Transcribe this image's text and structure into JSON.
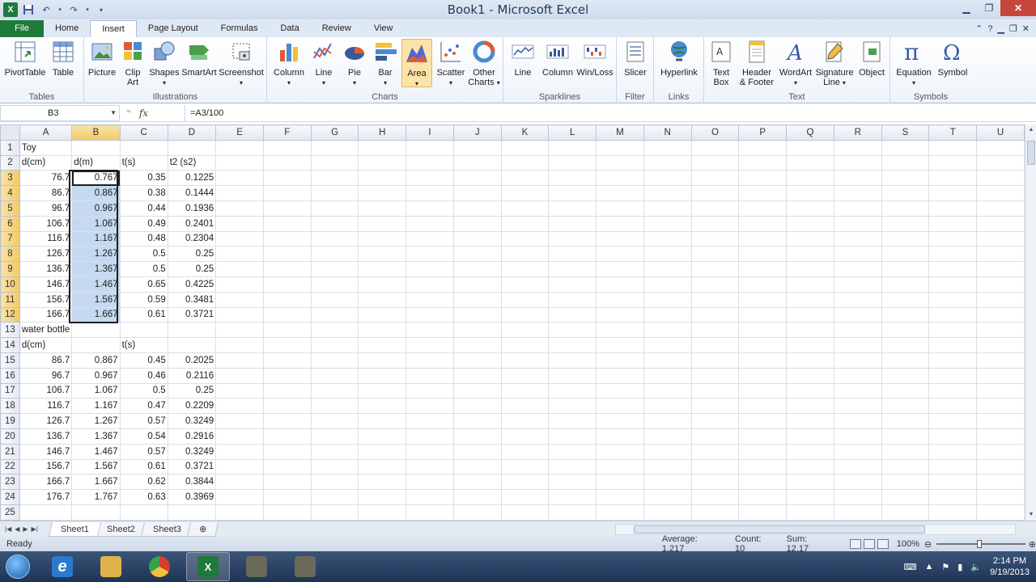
{
  "window": {
    "title": "Book1 - Microsoft Excel",
    "app_icon": "X"
  },
  "tabs": [
    {
      "label": "File"
    },
    {
      "label": "Home"
    },
    {
      "label": "Insert"
    },
    {
      "label": "Page Layout"
    },
    {
      "label": "Formulas"
    },
    {
      "label": "Data"
    },
    {
      "label": "Review"
    },
    {
      "label": "View"
    }
  ],
  "ribbon": {
    "groups": {
      "tables": "Tables",
      "illustrations": "Illustrations",
      "charts": "Charts",
      "sparklines": "Sparklines",
      "filter": "Filter",
      "links": "Links",
      "text": "Text",
      "symbols": "Symbols"
    },
    "buttons": {
      "pivottable": "PivotTable",
      "table": "Table",
      "picture": "Picture",
      "clipart_1": "Clip",
      "clipart_2": "Art",
      "shapes": "Shapes",
      "smartart": "SmartArt",
      "screenshot": "Screenshot",
      "column": "Column",
      "line": "Line",
      "pie": "Pie",
      "bar": "Bar",
      "area": "Area",
      "scatter": "Scatter",
      "othercharts_1": "Other",
      "othercharts_2": "Charts",
      "spark_line": "Line",
      "spark_column": "Column",
      "spark_winloss": "Win/Loss",
      "slicer": "Slicer",
      "hyperlink": "Hyperlink",
      "textbox_1": "Text",
      "textbox_2": "Box",
      "header_1": "Header",
      "header_2": "& Footer",
      "wordart": "WordArt",
      "signature_1": "Signature",
      "signature_2": "Line",
      "object": "Object",
      "equation": "Equation",
      "symbol": "Symbol"
    }
  },
  "formula_bar": {
    "name_box": "B3",
    "fx": "fx",
    "formula": "=A3/100"
  },
  "sheet": {
    "columns": [
      "A",
      "B",
      "C",
      "D",
      "E",
      "F",
      "G",
      "H",
      "I",
      "J",
      "K",
      "L",
      "M",
      "N",
      "O",
      "P",
      "Q",
      "R",
      "S",
      "T",
      "U"
    ],
    "rows": [
      {
        "n": "1",
        "a": "Toy",
        "b": "",
        "c": "",
        "d": ""
      },
      {
        "n": "2",
        "a": "d(cm)",
        "b": "d(m)",
        "c": "t(s)",
        "d": "t2 (s2)"
      },
      {
        "n": "3",
        "a": "76.7",
        "b": "0.767",
        "c": "0.35",
        "d": "0.1225"
      },
      {
        "n": "4",
        "a": "86.7",
        "b": "0.867",
        "c": "0.38",
        "d": "0.1444"
      },
      {
        "n": "5",
        "a": "96.7",
        "b": "0.967",
        "c": "0.44",
        "d": "0.1936"
      },
      {
        "n": "6",
        "a": "106.7",
        "b": "1.067",
        "c": "0.49",
        "d": "0.2401"
      },
      {
        "n": "7",
        "a": "116.7",
        "b": "1.167",
        "c": "0.48",
        "d": "0.2304"
      },
      {
        "n": "8",
        "a": "126.7",
        "b": "1.267",
        "c": "0.5",
        "d": "0.25"
      },
      {
        "n": "9",
        "a": "136.7",
        "b": "1.367",
        "c": "0.5",
        "d": "0.25"
      },
      {
        "n": "10",
        "a": "146.7",
        "b": "1.467",
        "c": "0.65",
        "d": "0.4225"
      },
      {
        "n": "11",
        "a": "156.7",
        "b": "1.567",
        "c": "0.59",
        "d": "0.3481"
      },
      {
        "n": "12",
        "a": "166.7",
        "b": "1.667",
        "c": "0.61",
        "d": "0.3721"
      },
      {
        "n": "13",
        "a": "water bottle",
        "b": "",
        "c": "",
        "d": ""
      },
      {
        "n": "14",
        "a": "d(cm)",
        "b": "",
        "c": "t(s)",
        "d": ""
      },
      {
        "n": "15",
        "a": "86.7",
        "b": "0.867",
        "c": "0.45",
        "d": "0.2025"
      },
      {
        "n": "16",
        "a": "96.7",
        "b": "0.967",
        "c": "0.46",
        "d": "0.2116"
      },
      {
        "n": "17",
        "a": "106.7",
        "b": "1.067",
        "c": "0.5",
        "d": "0.25"
      },
      {
        "n": "18",
        "a": "116.7",
        "b": "1.167",
        "c": "0.47",
        "d": "0.2209"
      },
      {
        "n": "19",
        "a": "126.7",
        "b": "1.267",
        "c": "0.57",
        "d": "0.3249"
      },
      {
        "n": "20",
        "a": "136.7",
        "b": "1.367",
        "c": "0.54",
        "d": "0.2916"
      },
      {
        "n": "21",
        "a": "146.7",
        "b": "1.467",
        "c": "0.57",
        "d": "0.3249"
      },
      {
        "n": "22",
        "a": "156.7",
        "b": "1.567",
        "c": "0.61",
        "d": "0.3721"
      },
      {
        "n": "23",
        "a": "166.7",
        "b": "1.667",
        "c": "0.62",
        "d": "0.3844"
      },
      {
        "n": "24",
        "a": "176.7",
        "b": "1.767",
        "c": "0.63",
        "d": "0.3969"
      },
      {
        "n": "25",
        "a": "",
        "b": "",
        "c": "",
        "d": ""
      }
    ],
    "selected_rows": [
      "3",
      "4",
      "5",
      "6",
      "7",
      "8",
      "9",
      "10",
      "11",
      "12"
    ],
    "selected_column": "B"
  },
  "sheet_tabs": [
    "Sheet1",
    "Sheet2",
    "Sheet3"
  ],
  "status": {
    "ready": "Ready",
    "average": "Average: 1.217",
    "count": "Count: 10",
    "sum": "Sum: 12.17",
    "zoom": "100%",
    "zoom_level_percent": 100
  },
  "taskbar": {
    "time": "2:14 PM",
    "date": "9/19/2013"
  },
  "colors": {
    "file_tab": "#1f7a3a",
    "selection": "#c5d9f1",
    "header_highlight": "#f2c966"
  }
}
